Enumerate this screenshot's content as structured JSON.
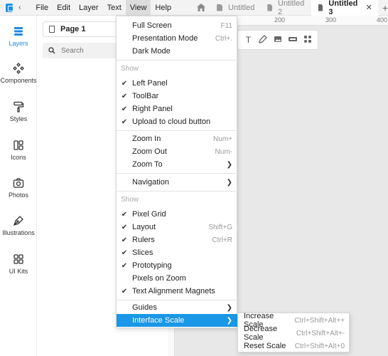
{
  "menubar": {
    "items": [
      "File",
      "Edit",
      "Layer",
      "Text",
      "View",
      "Help"
    ],
    "active": "View"
  },
  "tabs": [
    {
      "label": "Untitled",
      "active": false
    },
    {
      "label": "Untitled 2",
      "active": false
    },
    {
      "label": "Untitled 3",
      "active": true
    }
  ],
  "rail": [
    {
      "label": "Layers",
      "icon": "layers-icon",
      "active": true
    },
    {
      "label": "Components",
      "icon": "components-icon",
      "active": false
    },
    {
      "label": "Styles",
      "icon": "paint-roller-icon",
      "active": false
    },
    {
      "label": "Icons",
      "icon": "shapes-icon",
      "active": false
    },
    {
      "label": "Photos",
      "icon": "camera-icon",
      "active": false
    },
    {
      "label": "Illustrations",
      "icon": "pen-tool-icon",
      "active": false
    },
    {
      "label": "UI Kits",
      "icon": "ui-kits-icon",
      "active": false
    }
  ],
  "panel": {
    "page_label": "Page 1",
    "search_placeholder": "Search"
  },
  "ruler": {
    "labels": [
      "200",
      "300",
      "400"
    ]
  },
  "view_menu": {
    "full_screen": {
      "label": "Full Screen",
      "shortcut": "F11"
    },
    "presentation": {
      "label": "Presentation Mode",
      "shortcut": "Ctrl+."
    },
    "dark_mode": {
      "label": "Dark Mode"
    },
    "show_label_1": "Show",
    "left_panel": {
      "label": "Left Panel",
      "checked": true
    },
    "toolbar": {
      "label": "ToolBar",
      "checked": true
    },
    "right_panel": {
      "label": "Right Panel",
      "checked": true
    },
    "upload": {
      "label": "Upload to cloud button",
      "checked": true
    },
    "zoom_in": {
      "label": "Zoom In",
      "shortcut": "Num+"
    },
    "zoom_out": {
      "label": "Zoom Out",
      "shortcut": "Num-"
    },
    "zoom_to": {
      "label": "Zoom To"
    },
    "navigation": {
      "label": "Navigation"
    },
    "show_label_2": "Show",
    "pixel_grid": {
      "label": "Pixel Grid",
      "checked": true
    },
    "layout": {
      "label": "Layout",
      "shortcut": "Shift+G",
      "checked": true
    },
    "rulers": {
      "label": "Rulers",
      "shortcut": "Ctrl+R",
      "checked": true
    },
    "slices": {
      "label": "Slices",
      "checked": true
    },
    "prototyping": {
      "label": "Prototyping",
      "checked": true
    },
    "pixels_on_zoom": {
      "label": "Pixels on Zoom",
      "checked": false
    },
    "text_alignment": {
      "label": "Text Alignment Magnets",
      "checked": true
    },
    "guides": {
      "label": "Guides"
    },
    "interface_scale": {
      "label": "Interface Scale"
    }
  },
  "scale_submenu": {
    "increase": {
      "label": "Increase Scale",
      "shortcut": "Ctrl+Shift+Alt++"
    },
    "decrease": {
      "label": "Decrease Scale",
      "shortcut": "Ctrl+Shift+Alt+-"
    },
    "reset": {
      "label": "Reset Scale",
      "shortcut": "Ctrl+Shift+Alt+0"
    }
  },
  "check_glyph": "✔",
  "colors": {
    "accent": "#1a97e6",
    "menu_active": "#dcdcdc"
  }
}
